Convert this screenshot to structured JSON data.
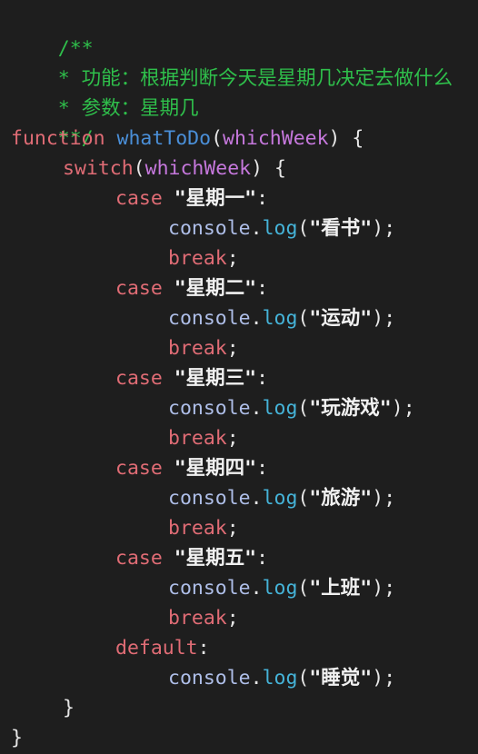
{
  "comment": {
    "open": "/**",
    "line1": "* 功能：根据判断今天是星期几决定去做什么",
    "line2": "* 参数：星期几",
    "close": "**/"
  },
  "func": {
    "keyword": "function",
    "name": "whatToDo",
    "param": "whichWeek",
    "open_paren": "(",
    "close_paren_brace": ") {"
  },
  "switch": {
    "keyword": "switch",
    "open_paren": "(",
    "arg": "whichWeek",
    "close_paren_brace": ") {"
  },
  "cases": [
    {
      "keyword": "case",
      "label": "\"星期一\"",
      "colon": ":",
      "obj": "console",
      "dot": ".",
      "method": "log",
      "lp": "(",
      "arg": "\"看书\"",
      "rp": ");",
      "brk": "break",
      "semi": ";"
    },
    {
      "keyword": "case",
      "label": "\"星期二\"",
      "colon": ":",
      "obj": "console",
      "dot": ".",
      "method": "log",
      "lp": "(",
      "arg": "\"运动\"",
      "rp": ");",
      "brk": "break",
      "semi": ";"
    },
    {
      "keyword": "case",
      "label": "\"星期三\"",
      "colon": ":",
      "obj": "console",
      "dot": ".",
      "method": "log",
      "lp": "(",
      "arg": "\"玩游戏\"",
      "rp": ");",
      "brk": "break",
      "semi": ";"
    },
    {
      "keyword": "case",
      "label": "\"星期四\"",
      "colon": ":",
      "obj": "console",
      "dot": ".",
      "method": "log",
      "lp": "(",
      "arg": "\"旅游\"",
      "rp": ");",
      "brk": "break",
      "semi": ";"
    },
    {
      "keyword": "case",
      "label": "\"星期五\"",
      "colon": ":",
      "obj": "console",
      "dot": ".",
      "method": "log",
      "lp": "(",
      "arg": "\"上班\"",
      "rp": ");",
      "brk": "break",
      "semi": ";"
    }
  ],
  "default_case": {
    "keyword": "default",
    "colon": ":",
    "obj": "console",
    "dot": ".",
    "method": "log",
    "lp": "(",
    "arg": "\"睡觉\"",
    "rp": ");"
  },
  "closing": {
    "switch_brace": "}",
    "func_brace": "}"
  },
  "colors": {
    "background": "#1e1e1e",
    "comment": "#2fbf4b",
    "keyword": "#e06c75",
    "function_name": "#4a8fd8",
    "parameter": "#c678dd",
    "string": "#f1f1f1"
  }
}
